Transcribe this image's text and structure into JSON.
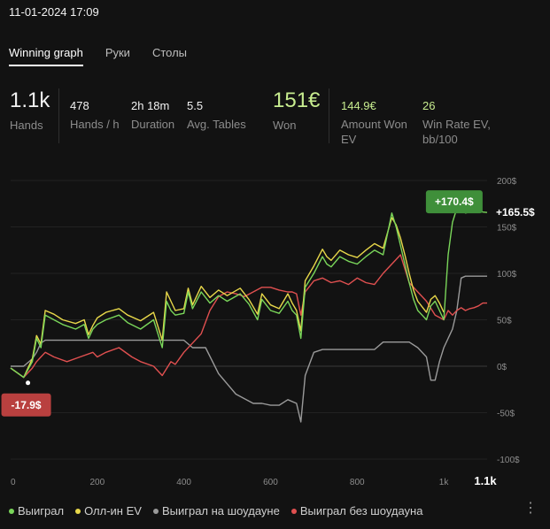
{
  "header": {
    "datetime": "11-01-2024 17:09"
  },
  "tabs": [
    {
      "label": "Winning graph",
      "active": true
    },
    {
      "label": "Руки",
      "active": false
    },
    {
      "label": "Столы",
      "active": false
    }
  ],
  "stats": {
    "hands": {
      "value": "1.1k",
      "label": "Hands"
    },
    "hands_per_hour": {
      "value": "478",
      "label": "Hands / h"
    },
    "duration": {
      "value": "2h 18m",
      "label": "Duration"
    },
    "avg_tables": {
      "value": "5.5",
      "label": "Avg. Tables"
    },
    "won": {
      "value": "151€",
      "label": "Won"
    },
    "amount_won_ev": {
      "value": "144.9€",
      "label_line1": "Amount Won",
      "label_line2": "EV"
    },
    "win_rate_ev": {
      "value": "26",
      "label_line1": "Win Rate EV,",
      "label_line2": "bb/100"
    }
  },
  "chart_data": {
    "type": "line",
    "xlim": [
      0,
      1100
    ],
    "ylim": [
      -100,
      200
    ],
    "grid": true,
    "x_ticks": [
      "0",
      "200",
      "400",
      "600",
      "800",
      "1k",
      "1.1k"
    ],
    "x_tick_values": [
      0,
      200,
      400,
      600,
      800,
      1000,
      1100
    ],
    "y_ticks": [
      "200$",
      "150$",
      "100$",
      "50$",
      "0$",
      "-50$",
      "-100$"
    ],
    "y_tick_values": [
      200,
      150,
      100,
      50,
      0,
      -50,
      -100
    ],
    "end_label": "+165.5$",
    "annotations": [
      {
        "text": "-17.9$",
        "x": 40,
        "y": -17.9,
        "color": "#b9403f"
      },
      {
        "text": "+170.4$",
        "x": 1065,
        "y": 170.4,
        "color": "#3f8f3a"
      }
    ],
    "series": [
      {
        "name": "Выиграл",
        "color": "#7ad65a",
        "x": [
          0,
          30,
          50,
          60,
          70,
          80,
          100,
          120,
          150,
          170,
          180,
          190,
          200,
          220,
          250,
          270,
          300,
          330,
          350,
          360,
          370,
          380,
          400,
          410,
          420,
          440,
          460,
          480,
          500,
          530,
          550,
          570,
          580,
          600,
          620,
          640,
          650,
          660,
          670,
          680,
          700,
          720,
          730,
          740,
          760,
          780,
          800,
          820,
          840,
          860,
          880,
          890,
          900,
          910,
          920,
          930,
          940,
          950,
          960,
          970,
          980,
          990,
          1000,
          1010,
          1020,
          1030,
          1040,
          1050,
          1060,
          1070,
          1080,
          1090,
          1100
        ],
        "y": [
          -2,
          -12,
          5,
          30,
          20,
          55,
          50,
          45,
          40,
          45,
          30,
          40,
          45,
          50,
          55,
          47,
          40,
          50,
          20,
          70,
          60,
          55,
          57,
          80,
          62,
          80,
          68,
          76,
          70,
          78,
          67,
          50,
          72,
          60,
          57,
          70,
          60,
          55,
          30,
          85,
          100,
          118,
          110,
          107,
          118,
          113,
          110,
          118,
          125,
          120,
          165,
          150,
          130,
          110,
          90,
          72,
          60,
          55,
          50,
          65,
          70,
          60,
          50,
          120,
          155,
          170,
          170,
          165,
          166,
          166,
          168,
          166,
          165.5
        ]
      },
      {
        "name": "Олл-ин EV",
        "color": "#e8d84a",
        "x": [
          0,
          30,
          50,
          60,
          70,
          80,
          100,
          120,
          150,
          170,
          180,
          190,
          200,
          220,
          250,
          270,
          300,
          330,
          350,
          360,
          370,
          380,
          400,
          410,
          420,
          440,
          460,
          480,
          500,
          530,
          550,
          570,
          580,
          600,
          620,
          640,
          650,
          660,
          670,
          680,
          700,
          720,
          730,
          740,
          760,
          780,
          800,
          820,
          840,
          860,
          880,
          890,
          900,
          910,
          920,
          930,
          940,
          950,
          960,
          970,
          980,
          990,
          1000
        ],
        "y": [
          -2,
          -12,
          8,
          33,
          24,
          60,
          56,
          50,
          46,
          50,
          34,
          44,
          52,
          58,
          62,
          55,
          49,
          58,
          28,
          80,
          70,
          60,
          62,
          84,
          66,
          86,
          74,
          82,
          76,
          84,
          72,
          56,
          78,
          66,
          62,
          78,
          68,
          60,
          38,
          92,
          108,
          126,
          118,
          114,
          125,
          120,
          117,
          125,
          132,
          127,
          160,
          152,
          138,
          120,
          100,
          82,
          70,
          64,
          58,
          72,
          76,
          68,
          58
        ]
      },
      {
        "name": "Выиграл на шоудауне",
        "color": "#9a9a9a",
        "x": [
          0,
          30,
          50,
          60,
          70,
          80,
          100,
          130,
          160,
          190,
          220,
          250,
          280,
          300,
          330,
          350,
          370,
          380,
          400,
          420,
          450,
          480,
          520,
          540,
          560,
          580,
          600,
          620,
          640,
          660,
          670,
          680,
          700,
          720,
          740,
          760,
          780,
          800,
          820,
          840,
          860,
          880,
          900,
          920,
          940,
          960,
          970,
          980,
          990,
          1000,
          1010,
          1020,
          1030,
          1040,
          1050,
          1060,
          1070,
          1080,
          1090,
          1100
        ],
        "y": [
          0,
          0,
          8,
          15,
          25,
          28,
          28,
          28,
          28,
          28,
          28,
          28,
          28,
          28,
          28,
          28,
          28,
          28,
          28,
          20,
          20,
          -8,
          -30,
          -35,
          -40,
          -40,
          -42,
          -42,
          -36,
          -40,
          -60,
          -10,
          15,
          18,
          18,
          18,
          18,
          18,
          18,
          18,
          26,
          26,
          26,
          26,
          20,
          10,
          -15,
          -15,
          5,
          20,
          30,
          40,
          60,
          95,
          97,
          97,
          97,
          97,
          97,
          97
        ]
      },
      {
        "name": "Выиграл без шоудауна",
        "color": "#e05050",
        "x": [
          0,
          30,
          50,
          60,
          70,
          80,
          100,
          130,
          160,
          190,
          200,
          220,
          250,
          280,
          300,
          330,
          350,
          370,
          380,
          400,
          420,
          440,
          460,
          480,
          500,
          520,
          540,
          560,
          580,
          600,
          620,
          640,
          650,
          660,
          670,
          680,
          700,
          720,
          740,
          760,
          780,
          800,
          820,
          840,
          860,
          880,
          900,
          920,
          940,
          960,
          980,
          1000,
          1010,
          1020,
          1030,
          1040,
          1050,
          1060,
          1070,
          1080,
          1090,
          1100
        ],
        "y": [
          -2,
          -12,
          -2,
          5,
          10,
          15,
          10,
          5,
          10,
          15,
          10,
          15,
          20,
          10,
          5,
          0,
          -10,
          5,
          2,
          15,
          25,
          35,
          60,
          75,
          80,
          78,
          75,
          80,
          85,
          85,
          82,
          80,
          80,
          78,
          55,
          80,
          92,
          95,
          90,
          92,
          88,
          95,
          90,
          88,
          100,
          110,
          120,
          90,
          80,
          70,
          55,
          50,
          60,
          55,
          60,
          63,
          60,
          62,
          63,
          65,
          68,
          68
        ]
      }
    ]
  },
  "legend": [
    {
      "label": "Выиграл",
      "color": "#7ad65a"
    },
    {
      "label": "Олл-ин EV",
      "color": "#e8d84a"
    },
    {
      "label": "Выиграл на шоудауне",
      "color": "#9a9a9a"
    },
    {
      "label": "Выиграл без шоудауна",
      "color": "#e05050"
    }
  ],
  "menu_icon": "more-vertical-icon"
}
